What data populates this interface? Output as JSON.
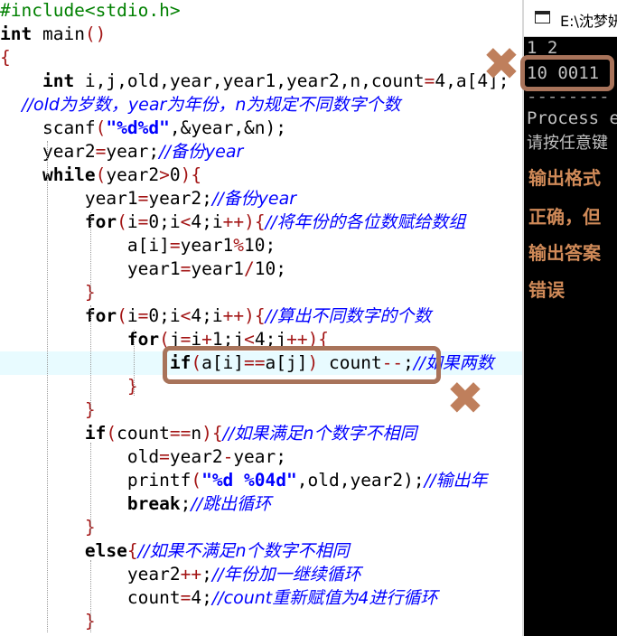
{
  "code_lines": [
    [
      {
        "t": "#include<stdio.h>",
        "c": "pp"
      }
    ],
    [
      {
        "t": "int",
        "c": "kw"
      },
      {
        "t": " main",
        "c": "tx"
      },
      {
        "t": "()",
        "c": "br"
      }
    ],
    [
      {
        "t": "{",
        "c": "br"
      }
    ],
    [
      {
        "t": "    int",
        "c": "kw"
      },
      {
        "t": " i,j,old,year,year1,year2,n,count",
        "c": "tx"
      },
      {
        "t": "=",
        "c": "op"
      },
      {
        "t": "4",
        "c": "tx"
      },
      {
        "t": ",a[4];",
        "c": "tx"
      }
    ],
    [
      {
        "t": "    //old为岁数，year为年份，n为规定不同数字个数",
        "c": "cm"
      }
    ],
    [
      {
        "t": "    scanf",
        "c": "tx"
      },
      {
        "t": "(",
        "c": "br"
      },
      {
        "t": "\"%d%d\"",
        "c": "str"
      },
      {
        "t": ",&year,&n);",
        "c": "tx"
      }
    ],
    [
      {
        "t": "    year2",
        "c": "tx"
      },
      {
        "t": "=",
        "c": "op"
      },
      {
        "t": "year;",
        "c": "tx"
      },
      {
        "t": "//备份year",
        "c": "cm"
      }
    ],
    [
      {
        "t": "    while",
        "c": "kw"
      },
      {
        "t": "(",
        "c": "br"
      },
      {
        "t": "year2",
        "c": "tx"
      },
      {
        "t": ">",
        "c": "op"
      },
      {
        "t": "0",
        "c": "tx"
      },
      {
        "t": "){",
        "c": "br"
      }
    ],
    [
      {
        "t": "        year1",
        "c": "tx"
      },
      {
        "t": "=",
        "c": "op"
      },
      {
        "t": "year2;",
        "c": "tx"
      },
      {
        "t": "//备份year",
        "c": "cm"
      }
    ],
    [
      {
        "t": "        for",
        "c": "kw"
      },
      {
        "t": "(",
        "c": "br"
      },
      {
        "t": "i",
        "c": "tx"
      },
      {
        "t": "=",
        "c": "op"
      },
      {
        "t": "0;i",
        "c": "tx"
      },
      {
        "t": "<",
        "c": "op"
      },
      {
        "t": "4;i",
        "c": "tx"
      },
      {
        "t": "++",
        "c": "op"
      },
      {
        "t": "){",
        "c": "br"
      },
      {
        "t": "//将年份的各位数赋给数组",
        "c": "cm"
      }
    ],
    [
      {
        "t": "            a[i]",
        "c": "tx"
      },
      {
        "t": "=",
        "c": "op"
      },
      {
        "t": "year1",
        "c": "tx"
      },
      {
        "t": "%",
        "c": "op"
      },
      {
        "t": "10;",
        "c": "tx"
      }
    ],
    [
      {
        "t": "            year1",
        "c": "tx"
      },
      {
        "t": "=",
        "c": "op"
      },
      {
        "t": "year1",
        "c": "tx"
      },
      {
        "t": "/",
        "c": "op"
      },
      {
        "t": "10;",
        "c": "tx"
      }
    ],
    [
      {
        "t": "        }",
        "c": "br"
      }
    ],
    [
      {
        "t": "        for",
        "c": "kw"
      },
      {
        "t": "(",
        "c": "br"
      },
      {
        "t": "i",
        "c": "tx"
      },
      {
        "t": "=",
        "c": "op"
      },
      {
        "t": "0;i",
        "c": "tx"
      },
      {
        "t": "<",
        "c": "op"
      },
      {
        "t": "4;i",
        "c": "tx"
      },
      {
        "t": "++",
        "c": "op"
      },
      {
        "t": "){",
        "c": "br"
      },
      {
        "t": "//算出不同数字的个数",
        "c": "cm"
      }
    ],
    [
      {
        "t": "            for",
        "c": "kw"
      },
      {
        "t": "(",
        "c": "br"
      },
      {
        "t": "j",
        "c": "tx"
      },
      {
        "t": "=",
        "c": "op"
      },
      {
        "t": "i",
        "c": "tx"
      },
      {
        "t": "+",
        "c": "op"
      },
      {
        "t": "1;j",
        "c": "tx"
      },
      {
        "t": "<",
        "c": "op"
      },
      {
        "t": "4;j",
        "c": "tx"
      },
      {
        "t": "++",
        "c": "op"
      },
      {
        "t": "){",
        "c": "br"
      }
    ],
    [
      {
        "t": "                if",
        "c": "kw"
      },
      {
        "t": "(",
        "c": "br"
      },
      {
        "t": "a[i]",
        "c": "tx"
      },
      {
        "t": "==",
        "c": "op"
      },
      {
        "t": "a[j]",
        "c": "tx"
      },
      {
        "t": ") ",
        "c": "br"
      },
      {
        "t": "count",
        "c": "tx"
      },
      {
        "t": "--",
        "c": "op"
      },
      {
        "t": ";",
        "c": "tx"
      },
      {
        "t": "//如果两数",
        "c": "cm"
      }
    ],
    [
      {
        "t": "            }",
        "c": "br"
      }
    ],
    [
      {
        "t": "        }",
        "c": "br"
      }
    ],
    [
      {
        "t": "        if",
        "c": "kw"
      },
      {
        "t": "(",
        "c": "br"
      },
      {
        "t": "count",
        "c": "tx"
      },
      {
        "t": "==",
        "c": "op"
      },
      {
        "t": "n",
        "c": "tx"
      },
      {
        "t": "){",
        "c": "br"
      },
      {
        "t": "//如果满足n个数字不相同",
        "c": "cm"
      }
    ],
    [
      {
        "t": "            old",
        "c": "tx"
      },
      {
        "t": "=",
        "c": "op"
      },
      {
        "t": "year2",
        "c": "tx"
      },
      {
        "t": "-",
        "c": "op"
      },
      {
        "t": "year;",
        "c": "tx"
      }
    ],
    [
      {
        "t": "            printf",
        "c": "tx"
      },
      {
        "t": "(",
        "c": "br"
      },
      {
        "t": "\"%d %04d\"",
        "c": "str"
      },
      {
        "t": ",old,year2);",
        "c": "tx"
      },
      {
        "t": "//输出年",
        "c": "cm"
      }
    ],
    [
      {
        "t": "            break",
        "c": "kw"
      },
      {
        "t": ";",
        "c": "tx"
      },
      {
        "t": "//跳出循环",
        "c": "cm"
      }
    ],
    [
      {
        "t": "        }",
        "c": "br"
      }
    ],
    [
      {
        "t": "        else",
        "c": "kw"
      },
      {
        "t": "{",
        "c": "br"
      },
      {
        "t": "//如果不满足n个数字不相同",
        "c": "cm"
      }
    ],
    [
      {
        "t": "            year2",
        "c": "tx"
      },
      {
        "t": "++",
        "c": "op"
      },
      {
        "t": ";",
        "c": "tx"
      },
      {
        "t": "//年份加一继续循环",
        "c": "cm"
      }
    ],
    [
      {
        "t": "            count",
        "c": "tx"
      },
      {
        "t": "=",
        "c": "op"
      },
      {
        "t": "4;",
        "c": "tx"
      },
      {
        "t": "//count重新赋值为4进行循环",
        "c": "cm"
      }
    ],
    [
      {
        "t": "        }",
        "c": "br"
      }
    ]
  ],
  "highlighted_line": 15,
  "console": {
    "title": "E:\\沈梦妍",
    "lines": [
      "1 2",
      "10 0011",
      "--------",
      "Process e",
      "请按任意键"
    ]
  },
  "notes": [
    "输出格式",
    "正确，但",
    "输出答案",
    "错误"
  ],
  "marks": {
    "x_symbol": "✖"
  },
  "colors": {
    "annotation": "#a8735a",
    "annotation_text": "#d08a58"
  }
}
